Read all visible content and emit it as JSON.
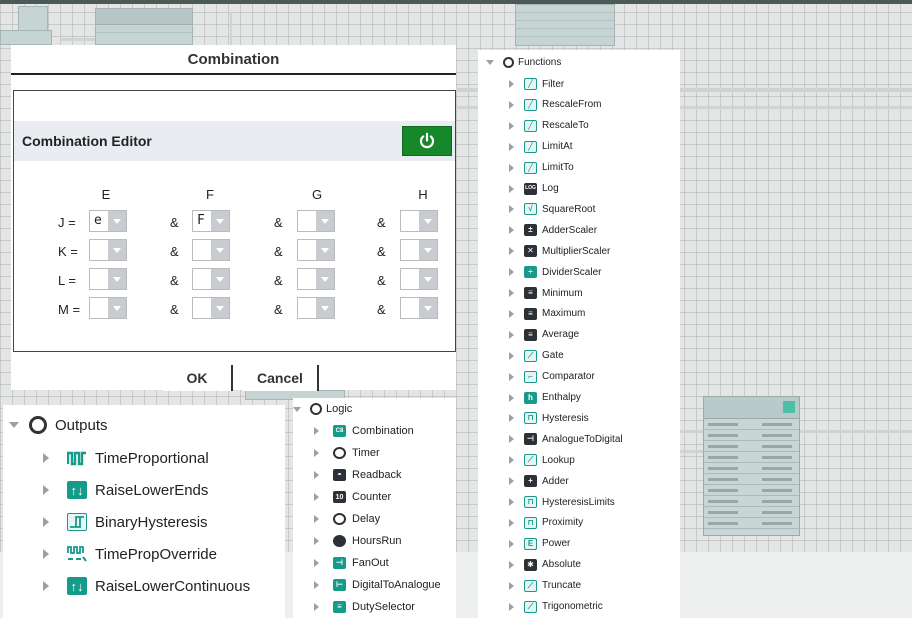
{
  "dialog": {
    "title": "Combination",
    "editor_title": "Combination Editor",
    "columns": [
      "E",
      "F",
      "G",
      "H"
    ],
    "rows": [
      {
        "label": "J =",
        "values": [
          "e",
          "F",
          "",
          ""
        ]
      },
      {
        "label": "K =",
        "values": [
          "",
          "",
          "",
          ""
        ]
      },
      {
        "label": "L =",
        "values": [
          "",
          "",
          "",
          ""
        ]
      },
      {
        "label": "M =",
        "values": [
          "",
          "",
          "",
          ""
        ]
      }
    ],
    "amp": "&",
    "ok_label": "OK",
    "cancel_label": "Cancel"
  },
  "outputs": {
    "title": "Outputs",
    "items": [
      {
        "label": "TimeProportional",
        "icon": "time-proportional-icon"
      },
      {
        "label": "RaiseLowerEnds",
        "icon": "raise-lower-ends-icon"
      },
      {
        "label": "BinaryHysteresis",
        "icon": "binary-hysteresis-icon"
      },
      {
        "label": "TimePropOverride",
        "icon": "time-prop-override-icon"
      },
      {
        "label": "RaiseLowerContinuous",
        "icon": "raise-lower-continuous-icon"
      }
    ]
  },
  "logic": {
    "title": "Logic",
    "items": [
      {
        "label": "Combination",
        "icon": "combination-icon"
      },
      {
        "label": "Timer",
        "icon": "timer-icon"
      },
      {
        "label": "Readback",
        "icon": "readback-icon"
      },
      {
        "label": "Counter",
        "icon": "counter-icon"
      },
      {
        "label": "Delay",
        "icon": "delay-icon"
      },
      {
        "label": "HoursRun",
        "icon": "hours-run-icon"
      },
      {
        "label": "FanOut",
        "icon": "fan-out-icon"
      },
      {
        "label": "DigitalToAnalogue",
        "icon": "digital-to-analogue-icon"
      },
      {
        "label": "DutySelector",
        "icon": "duty-selector-icon"
      }
    ]
  },
  "functions": {
    "title": "Functions",
    "items": [
      {
        "label": "Filter",
        "icon": "filter-icon"
      },
      {
        "label": "RescaleFrom",
        "icon": "rescale-from-icon"
      },
      {
        "label": "RescaleTo",
        "icon": "rescale-to-icon"
      },
      {
        "label": "LimitAt",
        "icon": "limit-at-icon"
      },
      {
        "label": "LimitTo",
        "icon": "limit-to-icon"
      },
      {
        "label": "Log",
        "icon": "log-icon"
      },
      {
        "label": "SquareRoot",
        "icon": "square-root-icon"
      },
      {
        "label": "AdderScaler",
        "icon": "adder-scaler-icon"
      },
      {
        "label": "MultiplierScaler",
        "icon": "multiplier-scaler-icon"
      },
      {
        "label": "DividerScaler",
        "icon": "divider-scaler-icon"
      },
      {
        "label": "Minimum",
        "icon": "minimum-icon"
      },
      {
        "label": "Maximum",
        "icon": "maximum-icon"
      },
      {
        "label": "Average",
        "icon": "average-icon"
      },
      {
        "label": "Gate",
        "icon": "gate-icon"
      },
      {
        "label": "Comparator",
        "icon": "comparator-icon"
      },
      {
        "label": "Enthalpy",
        "icon": "enthalpy-icon"
      },
      {
        "label": "Hysteresis",
        "icon": "hysteresis-icon"
      },
      {
        "label": "AnalogueToDigital",
        "icon": "analogue-to-digital-icon"
      },
      {
        "label": "Lookup",
        "icon": "lookup-icon"
      },
      {
        "label": "Adder",
        "icon": "adder-icon"
      },
      {
        "label": "HysteresisLimits",
        "icon": "hysteresis-limits-icon"
      },
      {
        "label": "Proximity",
        "icon": "proximity-icon"
      },
      {
        "label": "Power",
        "icon": "power-icon"
      },
      {
        "label": "Absolute",
        "icon": "absolute-icon"
      },
      {
        "label": "Truncate",
        "icon": "truncate-icon"
      },
      {
        "label": "Trigonometric",
        "icon": "trigonometric-icon"
      }
    ]
  },
  "colors": {
    "accent_green": "#16882a",
    "icon_teal": "#169a8a",
    "canvas": "#e3e6e5"
  }
}
